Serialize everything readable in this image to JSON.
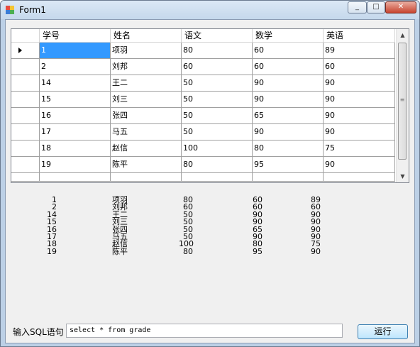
{
  "window": {
    "title": "Form1",
    "min_label": "_",
    "max_label": "□",
    "close_label": "✕"
  },
  "grid": {
    "columns": [
      "学号",
      "姓名",
      "语文",
      "数学",
      "英语"
    ],
    "rows": [
      [
        "1",
        "项羽",
        "80",
        "60",
        "89"
      ],
      [
        "2",
        "刘邦",
        "60",
        "60",
        "60"
      ],
      [
        "14",
        "王二",
        "50",
        "90",
        "90"
      ],
      [
        "15",
        "刘三",
        "50",
        "90",
        "90"
      ],
      [
        "16",
        "张四",
        "50",
        "65",
        "90"
      ],
      [
        "17",
        "马五",
        "50",
        "90",
        "90"
      ],
      [
        "18",
        "赵信",
        "100",
        "80",
        "75"
      ],
      [
        "19",
        "陈平",
        "80",
        "95",
        "90"
      ]
    ],
    "selected_row": 0
  },
  "output_rows": [
    [
      "1",
      "项羽",
      "80",
      "60",
      "89"
    ],
    [
      "2",
      "刘邦",
      "60",
      "60",
      "60"
    ],
    [
      "14",
      "王二",
      "50",
      "90",
      "90"
    ],
    [
      "15",
      "刘三",
      "50",
      "90",
      "90"
    ],
    [
      "16",
      "张四",
      "50",
      "65",
      "90"
    ],
    [
      "17",
      "马五",
      "50",
      "90",
      "90"
    ],
    [
      "18",
      "赵信",
      "100",
      "80",
      "75"
    ],
    [
      "19",
      "陈平",
      "80",
      "95",
      "90"
    ]
  ],
  "sql": {
    "label": "输入SQL语句",
    "value": "select * from grade"
  },
  "run_button": "运行"
}
